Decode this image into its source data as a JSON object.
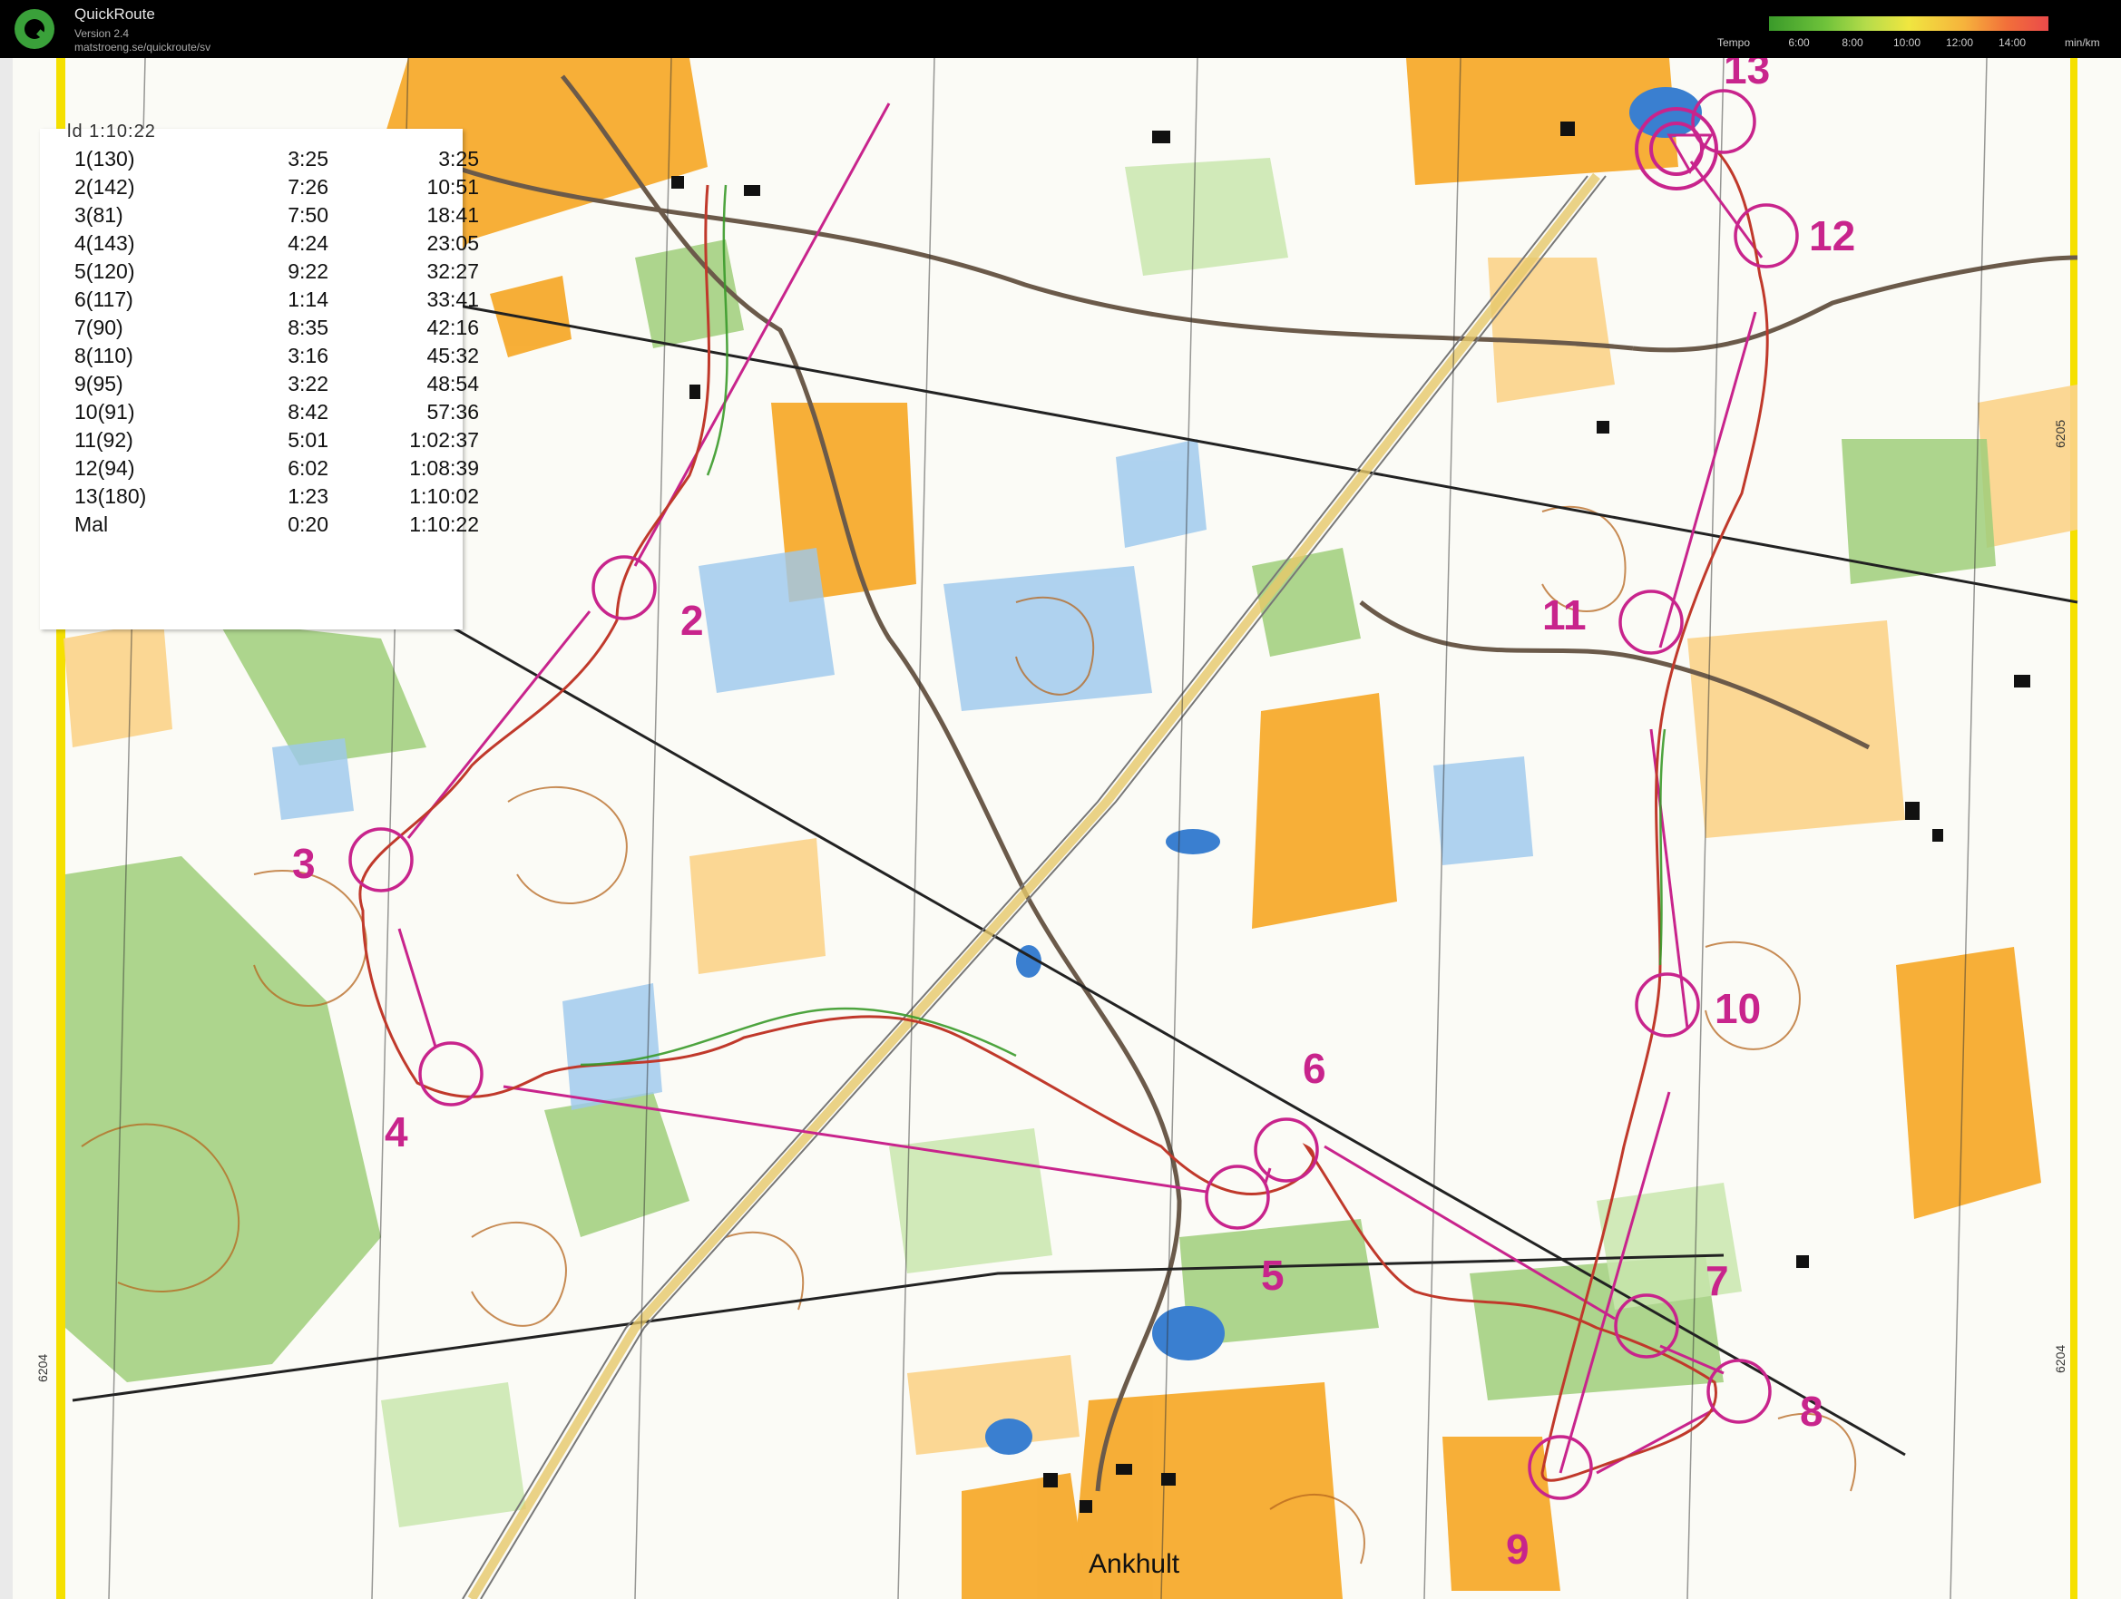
{
  "app": {
    "title": "QuickRoute",
    "version": "Version 2.4",
    "url": "matstroeng.se/quickroute/sv"
  },
  "tempo": {
    "label": "Tempo",
    "ticks": [
      "6:00",
      "8:00",
      "10:00",
      "12:00",
      "14:00"
    ],
    "unit": "min/km"
  },
  "splits_header": "ld        1:10:22",
  "splits": [
    {
      "name": "1(130)",
      "leg": "3:25",
      "cum": "3:25"
    },
    {
      "name": "2(142)",
      "leg": "7:26",
      "cum": "10:51"
    },
    {
      "name": "3(81)",
      "leg": "7:50",
      "cum": "18:41"
    },
    {
      "name": "4(143)",
      "leg": "4:24",
      "cum": "23:05"
    },
    {
      "name": "5(120)",
      "leg": "9:22",
      "cum": "32:27"
    },
    {
      "name": "6(117)",
      "leg": "1:14",
      "cum": "33:41"
    },
    {
      "name": "7(90)",
      "leg": "8:35",
      "cum": "42:16"
    },
    {
      "name": "8(110)",
      "leg": "3:16",
      "cum": "45:32"
    },
    {
      "name": "9(95)",
      "leg": "3:22",
      "cum": "48:54"
    },
    {
      "name": "10(91)",
      "leg": "8:42",
      "cum": "57:36"
    },
    {
      "name": "11(92)",
      "leg": "5:01",
      "cum": "1:02:37"
    },
    {
      "name": "12(94)",
      "leg": "6:02",
      "cum": "1:08:39"
    },
    {
      "name": "13(180)",
      "leg": "1:23",
      "cum": "1:10:02"
    },
    {
      "name": "Mal",
      "leg": "0:20",
      "cum": "1:10:22"
    }
  ],
  "controls": [
    {
      "label": "2"
    },
    {
      "label": "3"
    },
    {
      "label": "4"
    },
    {
      "label": "5"
    },
    {
      "label": "6"
    },
    {
      "label": "7"
    },
    {
      "label": "8"
    },
    {
      "label": "9"
    },
    {
      "label": "10"
    },
    {
      "label": "11"
    },
    {
      "label": "12"
    },
    {
      "label": "13"
    }
  ],
  "place_name": "Ankhult",
  "grid_labels": [
    "6204",
    "6204",
    "6205"
  ],
  "colors": {
    "course": "#c8248c",
    "route": "#c0392b",
    "forest_green": "#9fce7a",
    "open_yellow": "#f6a623",
    "water_blue": "#7fb8e6",
    "contour": "#b5651d",
    "road": "#6b5a4a",
    "border_yellow": "#f5e000"
  }
}
